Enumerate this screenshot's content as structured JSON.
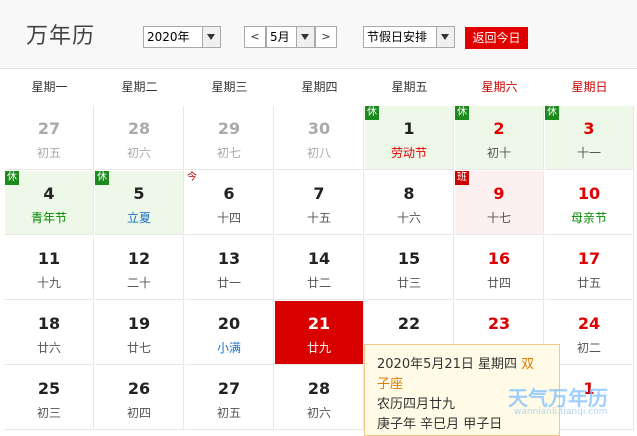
{
  "header": {
    "title": "万年历",
    "year_value": "2020年",
    "month_value": "5月",
    "prev_label": "<",
    "next_label": ">",
    "holiday_select": "节假日安排",
    "return_today": "返回今日"
  },
  "weekdays": [
    "星期一",
    "星期二",
    "星期三",
    "星期四",
    "星期五",
    "星期六",
    "星期日"
  ],
  "weeks": [
    [
      {
        "day": "27",
        "lunar": "初五",
        "state": "other"
      },
      {
        "day": "28",
        "lunar": "初六",
        "state": "other"
      },
      {
        "day": "29",
        "lunar": "初七",
        "state": "other"
      },
      {
        "day": "30",
        "lunar": "初八",
        "state": "other"
      },
      {
        "day": "1",
        "lunar": "劳动节",
        "state": "holiday",
        "badge": "休",
        "lunar_style": "fest-red"
      },
      {
        "day": "2",
        "lunar": "初十",
        "state": "holiday",
        "badge": "休"
      },
      {
        "day": "3",
        "lunar": "十一",
        "state": "holiday",
        "badge": "休"
      }
    ],
    [
      {
        "day": "4",
        "lunar": "青年节",
        "state": "holiday",
        "badge": "休",
        "lunar_style": "fest-green"
      },
      {
        "day": "5",
        "lunar": "立夏",
        "state": "holiday",
        "badge": "休",
        "lunar_style": "term"
      },
      {
        "day": "6",
        "lunar": "十四",
        "state": "normal",
        "badge": "今"
      },
      {
        "day": "7",
        "lunar": "十五",
        "state": "normal"
      },
      {
        "day": "8",
        "lunar": "十六",
        "state": "normal"
      },
      {
        "day": "9",
        "lunar": "十七",
        "state": "work",
        "badge": "班"
      },
      {
        "day": "10",
        "lunar": "母亲节",
        "state": "normal",
        "lunar_style": "fest-green"
      }
    ],
    [
      {
        "day": "11",
        "lunar": "十九",
        "state": "normal"
      },
      {
        "day": "12",
        "lunar": "二十",
        "state": "normal"
      },
      {
        "day": "13",
        "lunar": "廿一",
        "state": "normal"
      },
      {
        "day": "14",
        "lunar": "廿二",
        "state": "normal"
      },
      {
        "day": "15",
        "lunar": "廿三",
        "state": "normal"
      },
      {
        "day": "16",
        "lunar": "廿四",
        "state": "normal"
      },
      {
        "day": "17",
        "lunar": "廿五",
        "state": "normal"
      }
    ],
    [
      {
        "day": "18",
        "lunar": "廿六",
        "state": "normal"
      },
      {
        "day": "19",
        "lunar": "廿七",
        "state": "normal"
      },
      {
        "day": "20",
        "lunar": "小满",
        "state": "normal",
        "lunar_style": "term"
      },
      {
        "day": "21",
        "lunar": "廿九",
        "state": "selected"
      },
      {
        "day": "22",
        "lunar": "",
        "state": "normal"
      },
      {
        "day": "23",
        "lunar": "",
        "state": "normal"
      },
      {
        "day": "24",
        "lunar": "初二",
        "state": "normal"
      }
    ],
    [
      {
        "day": "25",
        "lunar": "初三",
        "state": "normal"
      },
      {
        "day": "26",
        "lunar": "初四",
        "state": "normal"
      },
      {
        "day": "27",
        "lunar": "初五",
        "state": "normal"
      },
      {
        "day": "28",
        "lunar": "初六",
        "state": "normal"
      },
      {
        "day": "",
        "lunar": "",
        "state": "normal"
      },
      {
        "day": "",
        "lunar": "",
        "state": "normal"
      },
      {
        "day": "1",
        "lunar": "",
        "state": "other-weekend"
      }
    ]
  ],
  "popup": {
    "date_line": "2020年5月21日 星期四",
    "zodiac": "双子座",
    "lunar_line": "农历四月廿九",
    "ganzhi_line": "庚子年 辛巳月 甲子日"
  },
  "watermark": {
    "text": "天气万年历",
    "subtext": "wannianli.tianqi.com"
  },
  "colors": {
    "accent": "#d90000",
    "holiday_bg": "#eef8e8",
    "work_bg": "#fdf0f0"
  }
}
